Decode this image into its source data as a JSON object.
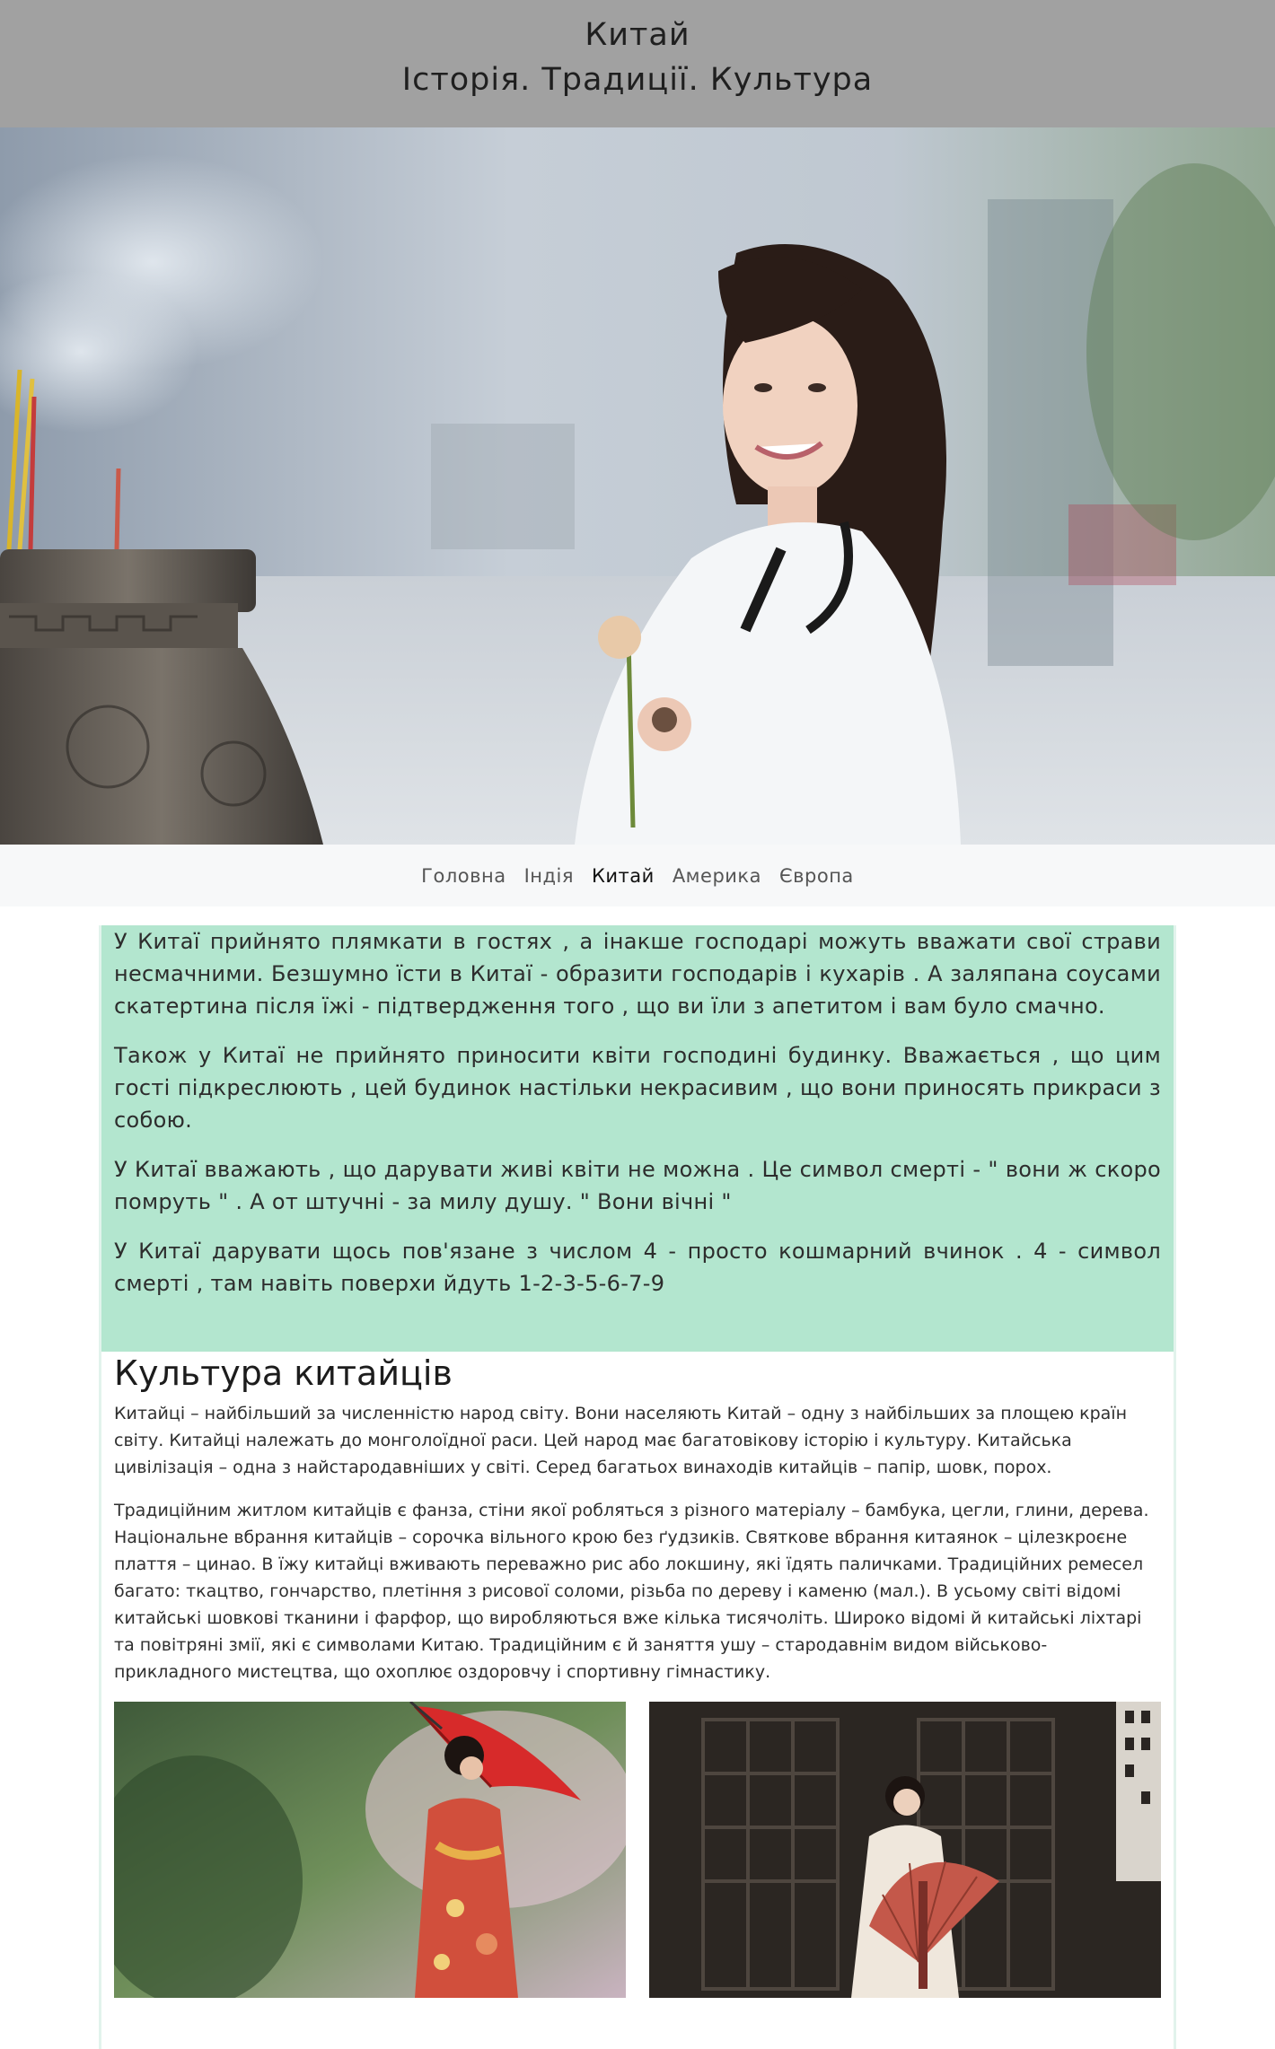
{
  "header": {
    "title": "Китай",
    "subtitle": "Історія. Традиції. Культура"
  },
  "nav": {
    "items": [
      {
        "label": "Головна"
      },
      {
        "label": "Індія"
      },
      {
        "label": "Китай",
        "active": true
      },
      {
        "label": "Америка"
      },
      {
        "label": "Європа"
      }
    ]
  },
  "customs": {
    "paragraphs": [
      "У Китаї прийнято плямкати в гостях , а інакше господарі можуть вважати свої страви несмачними. Безшумно їсти в Китаї - образити господарів і кухарів . А заляпана соусами скатертина після їжі - підтвердження того , що ви їли з апетитом і вам було смачно.",
      "Також у Китаї не прийнято приносити квіти господині будинку. Вважається , що цим гості підкреслюють , цей будинок настільки некрасивим , що вони приносять прикраси з собою.",
      "У Китаї вважають , що дарувати живі квіти не можна . Це символ смерті - \" вони ж скоро помруть \" . А от штучні - за милу душу. \" Вони вічні \"",
      "У Китаї дарувати щось пов'язане з числом 4 - просто кошмарний вчинок . 4 - символ смерті , там навіть поверхи йдуть 1-2-3-5-6-7-9"
    ]
  },
  "culture": {
    "heading": "Культура китайців",
    "paragraphs": [
      "Китайці – найбільший за численністю народ світу. Вони населяють Китай – одну з найбільших за площею країн світу. Китайці належать до монголоїдної раси. Цей народ має багатовікову історію і культуру. Китайська цивілізація – одна з найстародавніших у світі. Серед багатьох винаходів китайців – папір, шовк, порох.",
      "Традиційним житлом китайців є фанза, стіни якої робляться з різного матеріалу – бамбука, цегли, глини, дерева. Національне вбрання китайців – сорочка вільного крою без ґудзиків. Святкове вбрання китаянок – цілезкроєне плаття – цинао. В їжу китайці вживають переважно рис або локшину, які їдять паличками. Традиційних ремесел багато: ткацтво, гончарство, плетіння з рисової соломи, різьба по дереву і каменю (мал.). В усьому світі відомі китайські шовкові тканини і фарфор, що виробляються вже кілька тисячоліть. Широко відомі й китайські ліхтарі та повітряні змії, які є символами Китаю. Традиційним є й заняття ушу – стародавнім видом військово-прикладного мистецтва, що охоплює оздоровчу і спортивну гімнастику."
    ]
  },
  "images": {
    "hero": "hero-photo-girl-with-incense",
    "photo_left": "photo-woman-kimono-red-umbrella",
    "photo_right": "photo-woman-hanfu-fan"
  }
}
